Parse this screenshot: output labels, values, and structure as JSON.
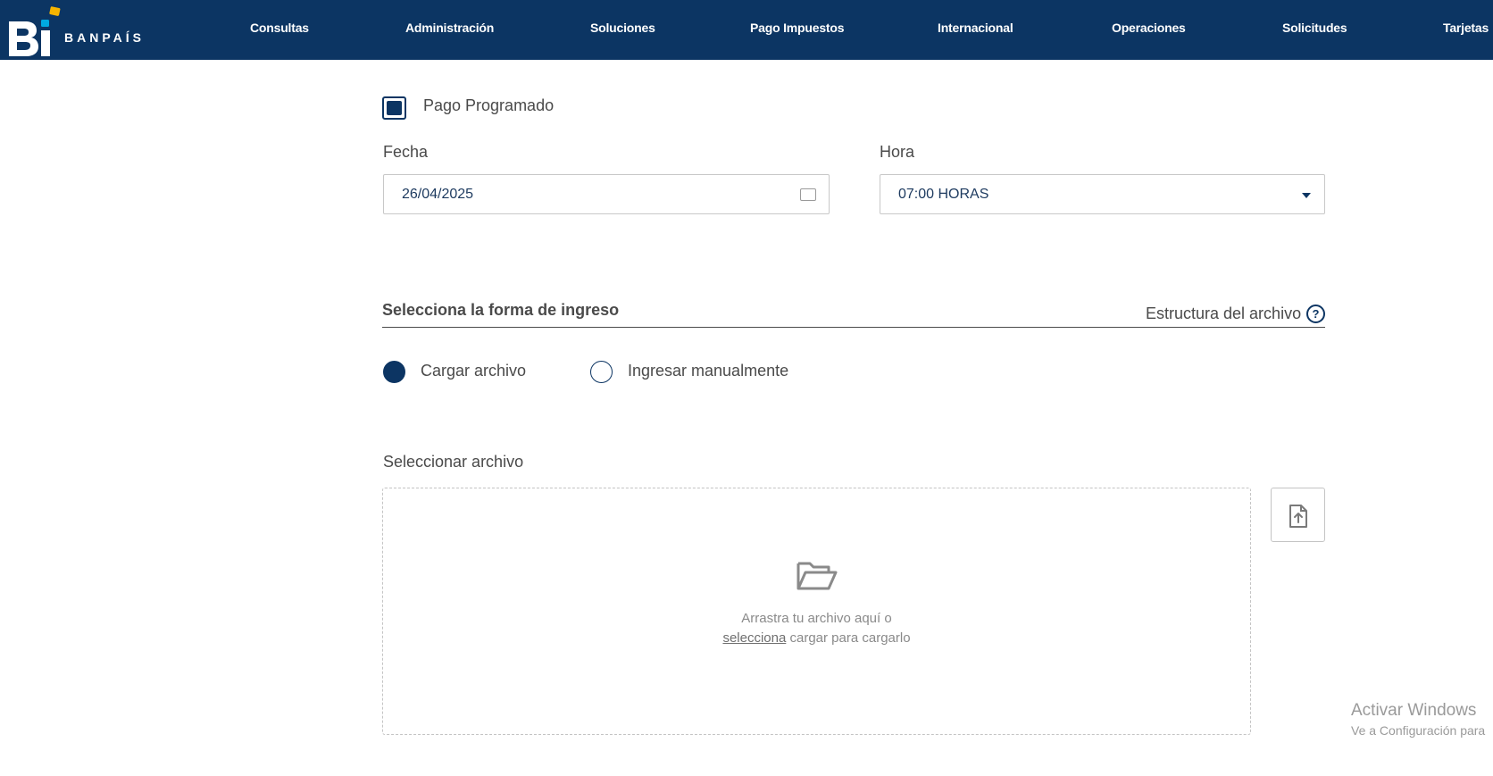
{
  "header": {
    "logo_text": "BANPAÍS",
    "nav": [
      {
        "label": "Consultas"
      },
      {
        "label": "Administración"
      },
      {
        "label": "Soluciones"
      },
      {
        "label": "Pago Impuestos"
      },
      {
        "label": "Internacional"
      },
      {
        "label": "Operaciones"
      },
      {
        "label": "Solicitudes"
      },
      {
        "label": "Tarjetas"
      }
    ]
  },
  "schedule": {
    "checkbox_label": "Pago Programado",
    "checked": true,
    "date_label": "Fecha",
    "date_value": "26/04/2025",
    "time_label": "Hora",
    "time_value": "07:00 HORAS"
  },
  "entry": {
    "section_title": "Selecciona la forma de ingreso",
    "structure_link": "Estructura del archivo",
    "help_glyph": "?",
    "options": [
      {
        "label": "Cargar archivo",
        "selected": true
      },
      {
        "label": "Ingresar manualmente",
        "selected": false
      }
    ]
  },
  "upload": {
    "label": "Seleccionar archivo",
    "drop_text": "Arrastra tu archivo aquí o",
    "select_link": "selecciona",
    "drop_suffix": " cargar para cargarlo"
  },
  "watermark": {
    "title": "Activar Windows",
    "subtitle": "Ve a Configuración para"
  },
  "colors": {
    "brand_navy": "#0c3563",
    "logo_yellow": "#f5b400",
    "logo_cyan": "#00a9e0"
  }
}
